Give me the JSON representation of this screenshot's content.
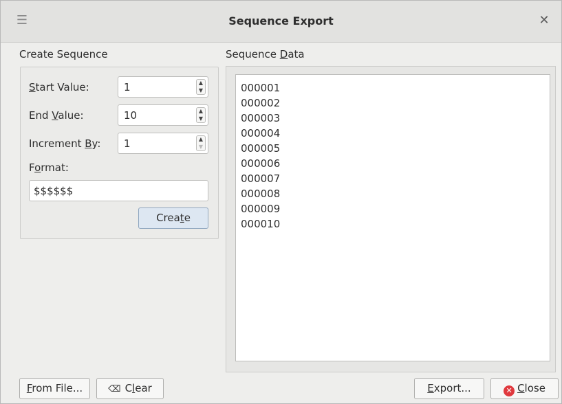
{
  "window": {
    "title": "Sequence Export",
    "menu_icon": "hamburger-menu-icon",
    "close_icon": "close-icon"
  },
  "create_sequence": {
    "heading": "Create Sequence",
    "start_value": {
      "label_pre": "",
      "label_key": "S",
      "label_post": "tart Value:",
      "value": "1"
    },
    "end_value": {
      "label_pre": "End ",
      "label_key": "V",
      "label_post": "alue:",
      "value": "10"
    },
    "increment_by": {
      "label_pre": "Increment ",
      "label_key": "B",
      "label_post": "y:",
      "value": "1"
    },
    "format": {
      "label_pre": "F",
      "label_key": "o",
      "label_post": "rmat:",
      "value": "$$$$$$"
    },
    "create_button": {
      "pre": "Crea",
      "key": "t",
      "post": "e"
    }
  },
  "sequence_data": {
    "heading_pre": "Sequence ",
    "heading_key": "D",
    "heading_post": "ata",
    "lines": [
      "000001",
      "000002",
      "000003",
      "000004",
      "000005",
      "000006",
      "000007",
      "000008",
      "000009",
      "000010"
    ]
  },
  "footer": {
    "from_file": {
      "key": "F",
      "post": "rom File..."
    },
    "clear": {
      "icon": "backspace-clear-icon",
      "pre": "C",
      "key": "l",
      "post": "ear"
    },
    "export": {
      "key": "E",
      "post": "xport..."
    },
    "close": {
      "icon": "close-circle-icon",
      "key": "C",
      "post": "lose"
    }
  },
  "colors": {
    "close_icon_red": "#e0393e",
    "create_button_blue": "#dde7f2"
  }
}
